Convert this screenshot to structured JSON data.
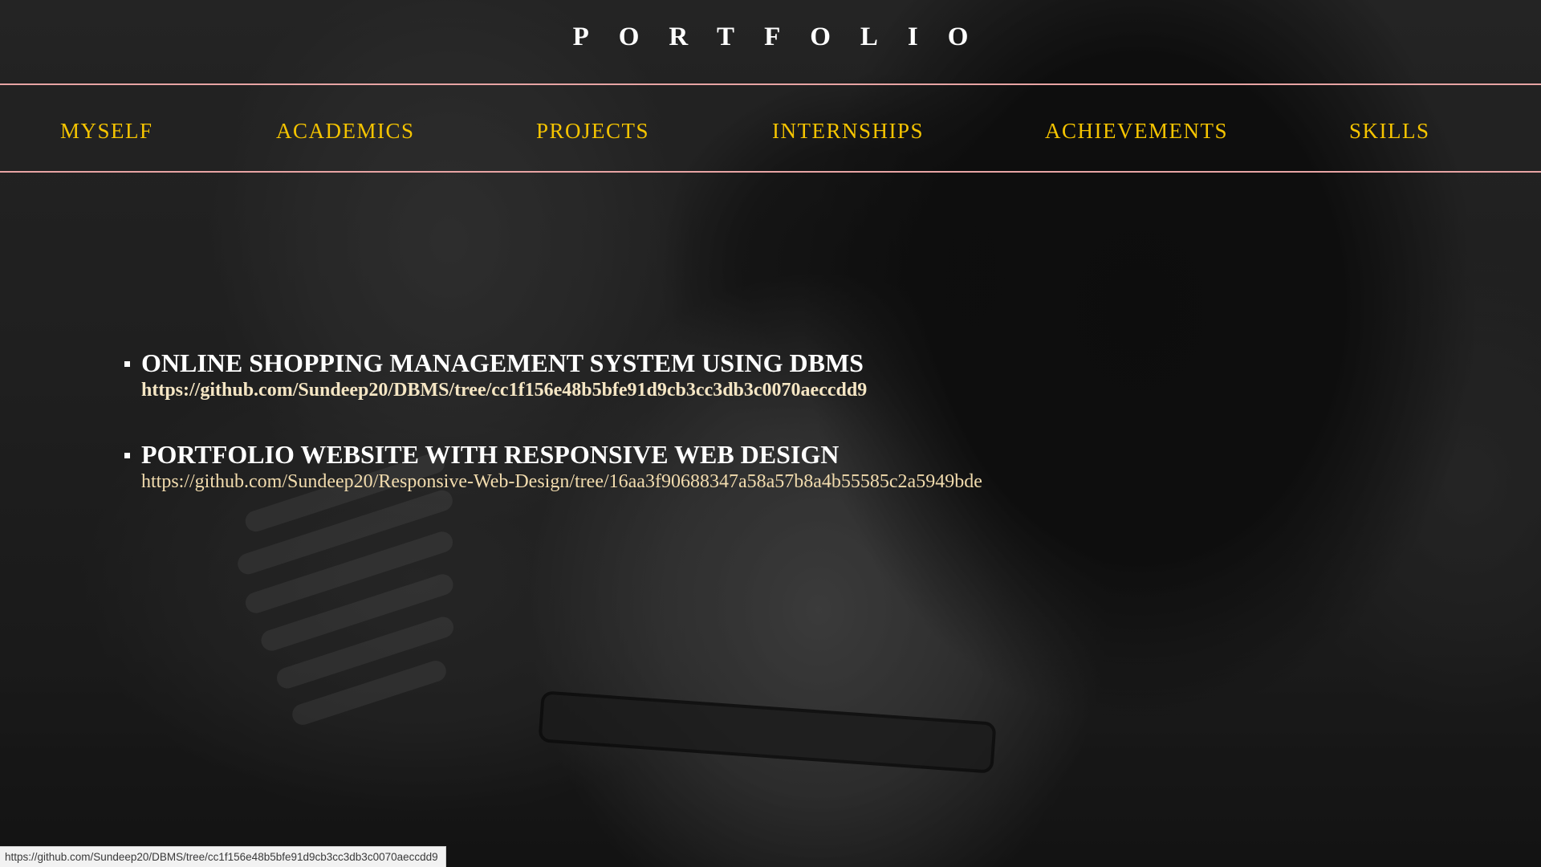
{
  "header": {
    "title": "PORTFOLIO"
  },
  "nav": {
    "items": [
      {
        "label": "MYSELF"
      },
      {
        "label": "ACADEMICS"
      },
      {
        "label": "PROJECTS"
      },
      {
        "label": "INTERNSHIPS"
      },
      {
        "label": "ACHIEVEMENTS"
      },
      {
        "label": "SKILLS"
      }
    ]
  },
  "projects": [
    {
      "title": "ONLINE SHOPPING MANAGEMENT SYSTEM USING DBMS",
      "link": "https://github.com/Sundeep20/DBMS/tree/cc1f156e48b5bfe91d9cb3cc3db3c0070aeccdd9"
    },
    {
      "title": "PORTFOLIO WEBSITE WITH RESPONSIVE WEB DESIGN",
      "link": "https://github.com/Sundeep20/Responsive-Web-Design/tree/16aa3f90688347a58a57b8a4b55585c2a5949bde"
    }
  ],
  "status_bar": {
    "url": "https://github.com/Sundeep20/DBMS/tree/cc1f156e48b5bfe91d9cb3cc3db3c0070aeccdd9"
  },
  "colors": {
    "nav_text": "#f5c400",
    "nav_divider": "#e8a4a4",
    "link_text": "#f2dcae",
    "title_text": "#ffffff"
  }
}
